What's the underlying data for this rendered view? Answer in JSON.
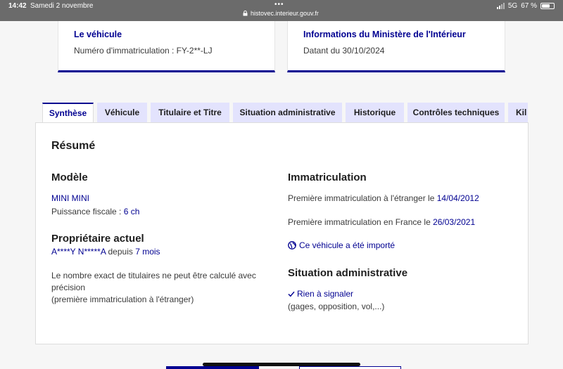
{
  "status_bar": {
    "time": "14:42",
    "date": "Samedi 2 novembre",
    "url": "histovec.interieur.gouv.fr",
    "network": "5G",
    "battery": "67 %",
    "battery_level": 0.67
  },
  "cards": {
    "vehicle": {
      "title": "Le véhicule",
      "text": "Numéro d'immatriculation : FY-2**-LJ"
    },
    "ministry": {
      "title": "Informations du Ministère de l'Intérieur",
      "text": "Datant du 30/10/2024"
    }
  },
  "tabs": [
    {
      "label": "Synthèse",
      "active": true
    },
    {
      "label": "Véhicule"
    },
    {
      "label": "Titulaire et Titre"
    },
    {
      "label": "Situation administrative"
    },
    {
      "label": "Historique"
    },
    {
      "label": "Contrôles techniques"
    },
    {
      "label": "Kil"
    }
  ],
  "summary": {
    "title": "Résumé",
    "model": {
      "heading": "Modèle",
      "name": "MINI MINI",
      "power_label": "Puissance fiscale : ",
      "power_value": "6 ch"
    },
    "owner": {
      "heading": "Propriétaire actuel",
      "name": "A****Y N*****A",
      "since_prefix": " depuis ",
      "since_value": "7 mois",
      "note_line1": "Le nombre exact de titulaires ne peut être calculé avec",
      "note_line2": "précision",
      "note_line3": "(première immatriculation à l'étranger)"
    },
    "registration": {
      "heading": "Immatriculation",
      "foreign_label": "Première immatriculation à l'étranger le ",
      "foreign_date": "14/04/2012",
      "france_label": "Première immatriculation en France le ",
      "france_date": "26/03/2021",
      "imported_link": "Ce véhicule a été importé"
    },
    "admin": {
      "heading": "Situation administrative",
      "status": "Rien à signaler",
      "details": "(gages, opposition, vol,...)"
    }
  }
}
